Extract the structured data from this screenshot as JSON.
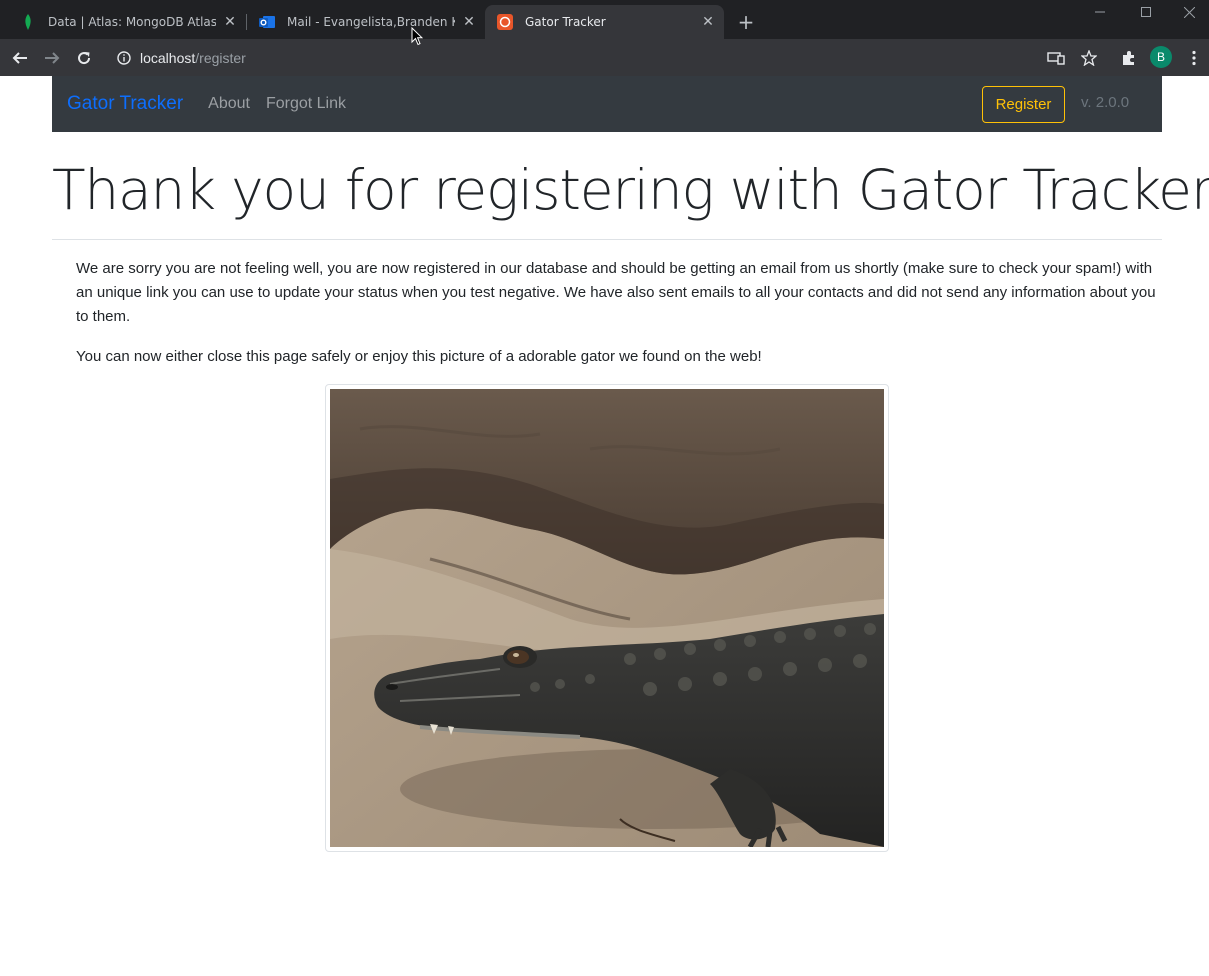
{
  "browser": {
    "tabs": [
      {
        "title": "Data | Atlas: MongoDB Atlas",
        "icon": "mongodb-leaf-icon"
      },
      {
        "title": "Mail - Evangelista,Branden K - Ou",
        "icon": "outlook-icon"
      },
      {
        "title": "Gator Tracker",
        "icon": "gator-tracker-icon"
      }
    ],
    "active_tab": 2,
    "url_host": "localhost",
    "url_path": "/register",
    "profile_initial": "B"
  },
  "navbar": {
    "brand": "Gator Tracker",
    "links": [
      "About",
      "Forgot Link"
    ],
    "register_label": "Register",
    "version": "v. 2.0.0"
  },
  "main": {
    "heading": "Thank you for registering with Gator Tracker!",
    "paragraph1": "We are sorry you are not feeling well, you are now registered in our database and should be getting an email from us shortly (make sure to check your spam!) with an unique link you can use to update your status when you test negative. We have also sent emails to all your contacts and did not send any information about you to them.",
    "paragraph2": "You can now either close this page safely or enjoy this picture of a adorable gator we found on the web!"
  },
  "colors": {
    "navbar_bg": "#343a40",
    "brand": "#0d6efd",
    "register_outline": "#ffc107"
  }
}
